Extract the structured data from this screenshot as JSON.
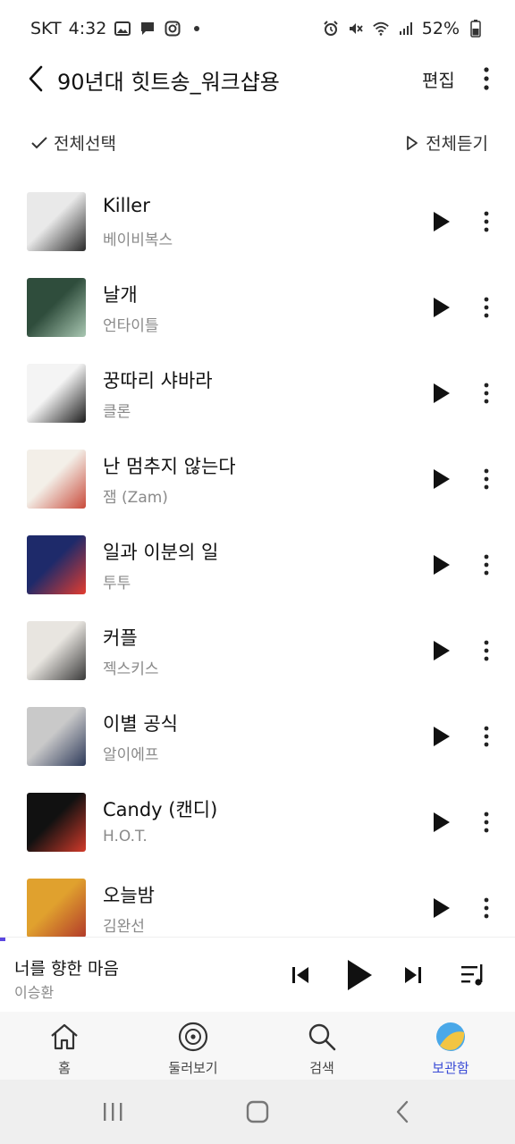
{
  "status": {
    "carrier": "SKT",
    "time": "4:32",
    "battery": "52%"
  },
  "header": {
    "title": "90년대 힛트송_워크샵용",
    "edit_label": "편집"
  },
  "actions": {
    "select_all": "전체선택",
    "play_all": "전체듣기"
  },
  "tracks": [
    {
      "title": "Killer",
      "artist": "베이비복스",
      "cover_colors": [
        "#e9e9e9",
        "#2a2a2a"
      ]
    },
    {
      "title": "날개",
      "artist": "언타이틀",
      "cover_colors": [
        "#2f4d3c",
        "#a9c7b2"
      ]
    },
    {
      "title": "꿍따리 샤바라",
      "artist": "클론",
      "cover_colors": [
        "#f4f4f4",
        "#1c1c1c"
      ]
    },
    {
      "title": "난 멈추지 않는다",
      "artist": "잼 (Zam)",
      "cover_colors": [
        "#f3efe8",
        "#c94b3b"
      ]
    },
    {
      "title": "일과 이분의 일",
      "artist": "투투",
      "cover_colors": [
        "#1e2a6a",
        "#e33c2f"
      ]
    },
    {
      "title": "커플",
      "artist": "젝스키스",
      "cover_colors": [
        "#e8e5e0",
        "#3a3a3a"
      ]
    },
    {
      "title": "이별 공식",
      "artist": "알이에프",
      "cover_colors": [
        "#c9c9c9",
        "#2e3a5a"
      ]
    },
    {
      "title": "Candy (캔디)",
      "artist": "H.O.T.",
      "cover_colors": [
        "#111111",
        "#d23a2a"
      ]
    },
    {
      "title": "오늘밤",
      "artist": "김완선",
      "cover_colors": [
        "#e0a12e",
        "#b23a2a"
      ]
    }
  ],
  "miniplayer": {
    "title": "너를 향한 마음",
    "artist": "이승환",
    "progress": 0.01
  },
  "nav": {
    "items": [
      {
        "label": "홈",
        "icon": "home-icon"
      },
      {
        "label": "둘러보기",
        "icon": "disc-icon"
      },
      {
        "label": "검색",
        "icon": "search-icon"
      },
      {
        "label": "보관함",
        "icon": "library-icon"
      }
    ],
    "active_index": 3,
    "active_color": "#3a4bd6"
  },
  "colors": {
    "accent": "#5b47e0",
    "text_secondary": "#8a8a8a"
  }
}
